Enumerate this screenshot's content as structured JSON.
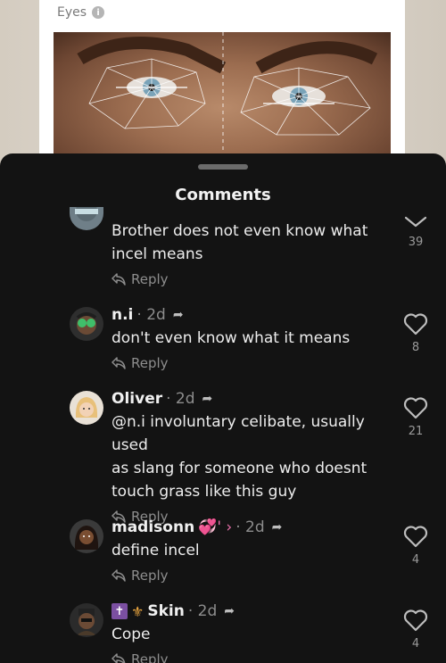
{
  "photo": {
    "label": "Eyes",
    "info_icon": "info-icon"
  },
  "sheet": {
    "title": "Comments"
  },
  "comments": [
    {
      "name": "",
      "time": "",
      "text_lines": [
        "Brother does not even know what",
        "incel means"
      ],
      "reply": "Reply",
      "likes": "39",
      "like_icon": "chevron-down-icon"
    },
    {
      "name": "n.i",
      "time": "· 2d",
      "text_lines": [
        "don't even know what it means"
      ],
      "reply": "Reply",
      "likes": "8"
    },
    {
      "name": "Oliver",
      "time": "· 2d",
      "text_lines": [
        "@n.i involuntary celibate, usually used",
        "as slang for someone who doesnt",
        "touch grass like this guy"
      ],
      "reply": "Reply",
      "likes": "21"
    },
    {
      "name": "madisonn",
      "name_suffix": "💞' ›",
      "time": "· 2d",
      "text_lines": [
        "define incel"
      ],
      "reply": "Reply",
      "likes": "4"
    },
    {
      "name_prefix_cross": "✝",
      "name_prefix_fleur": "⚜",
      "name": "Skin",
      "time": "· 2d",
      "text_lines": [
        "Cope"
      ],
      "reply": "Reply",
      "likes": "4"
    }
  ],
  "colors": {
    "sheet_bg": "#131313",
    "muted": "#8d8d8d"
  }
}
